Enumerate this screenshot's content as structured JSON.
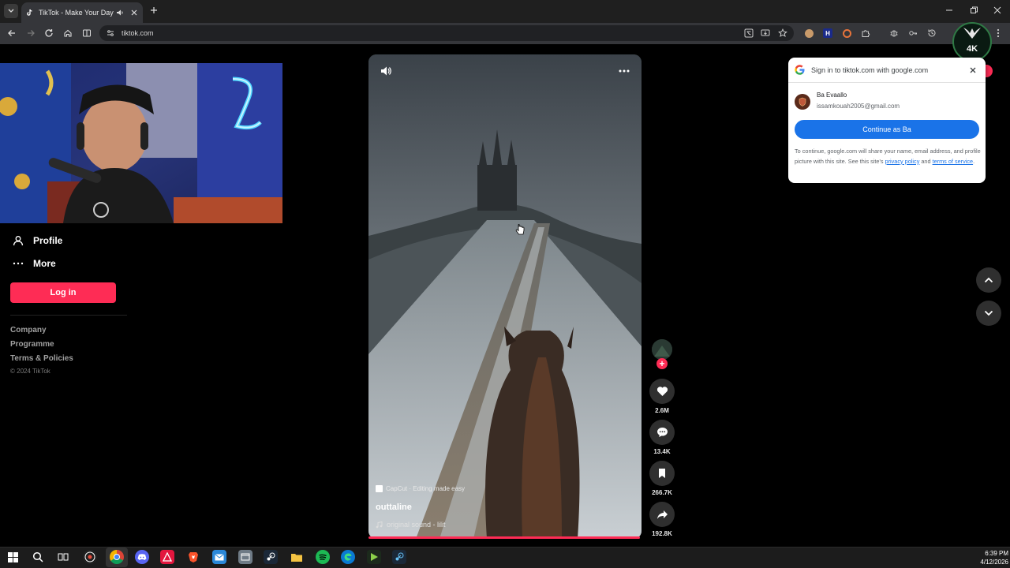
{
  "browser": {
    "tab_title": "TikTok - Make Your Day",
    "url": "tiktok.com"
  },
  "sidebar": {
    "nav": [
      {
        "label": "Profile",
        "icon": "person-icon"
      },
      {
        "label": "More",
        "icon": "more-dots-icon"
      }
    ],
    "login_label": "Log in",
    "footer_links": [
      "Company",
      "Programme",
      "Terms & Policies"
    ],
    "copyright": "© 2024 TikTok"
  },
  "video": {
    "capcut_label": "CapCut · Editing made easy",
    "title": "outtaline",
    "sound": "original sound - lilit"
  },
  "actions": {
    "likes": "2.6M",
    "comments": "13.4K",
    "saves": "266.7K",
    "shares": "192.8K"
  },
  "google_popup": {
    "header": "Sign in to tiktok.com with google.com",
    "account_name": "Ba Evaallo",
    "account_email": "issamkouah2005@gmail.com",
    "continue_label": "Continue as Ba",
    "note_prefix": "To continue, google.com will share your name, email address, and profile picture with this site. See this site's ",
    "privacy_link": "privacy policy",
    "note_and": " and ",
    "terms_link": "terms of service",
    "note_end": "."
  },
  "watermark": {
    "text": "4K"
  },
  "taskbar": {
    "time": "6:39 PM",
    "date": "4/12/2026"
  },
  "colors": {
    "accent": "#fe2c55",
    "google_blue": "#1a73e8",
    "chrome_dark": "#35363a"
  }
}
